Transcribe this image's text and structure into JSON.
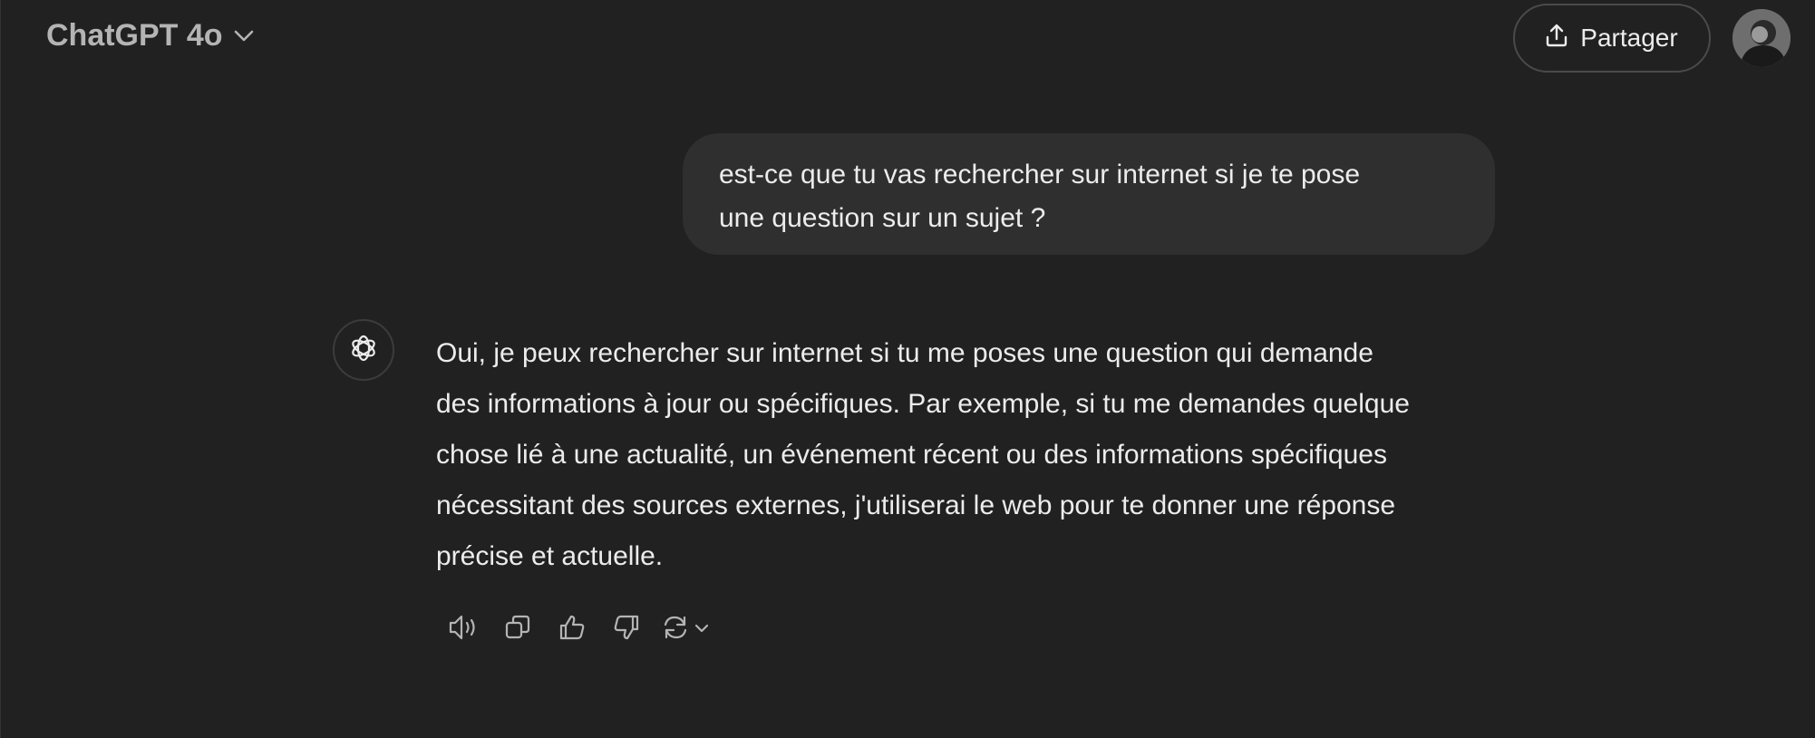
{
  "header": {
    "model_label": "ChatGPT 4o",
    "share_label": "Partager"
  },
  "conversation": {
    "user_message": {
      "lines": [
        "est-ce que tu vas rechercher sur internet si je te pose",
        "une question sur un sujet ?"
      ]
    },
    "assistant_message": {
      "lines": [
        "Oui, je peux rechercher sur internet si tu me poses une question qui demande",
        "des informations à jour ou spécifiques. Par exemple, si tu me demandes quelque",
        "chose lié à une actualité, un événement récent ou des informations spécifiques",
        "nécessitant des sources externes, j'utiliserai le web pour te donner une réponse",
        "précise et actuelle."
      ]
    },
    "actions": [
      {
        "name": "read-aloud-icon"
      },
      {
        "name": "copy-icon"
      },
      {
        "name": "thumbs-up-icon"
      },
      {
        "name": "thumbs-down-icon"
      },
      {
        "name": "regenerate-icon"
      }
    ]
  },
  "colors": {
    "background": "#212121",
    "bubble": "#2f2f2f",
    "text": "#ececec",
    "muted": "#b4b4b4"
  }
}
